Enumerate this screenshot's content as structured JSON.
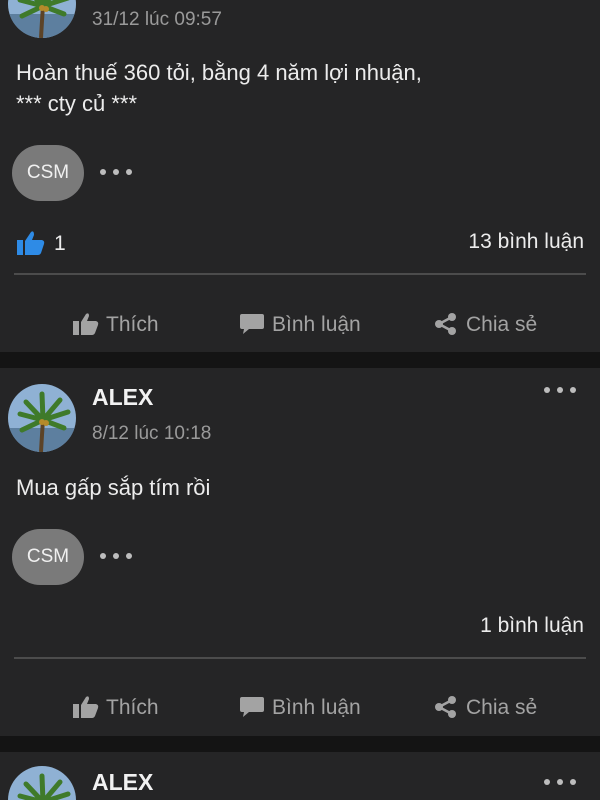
{
  "posts": [
    {
      "author": "",
      "time": "31/12 lúc 09:57",
      "text": "Hoàn thuế 360 tỏi, bằng 4 năm lợi nhuận,\n*** cty củ ***",
      "reaction_chip": "CSM",
      "like_count": "1",
      "comment_count": "13 bình luận",
      "actions": {
        "like": "Thích",
        "comment": "Bình luận",
        "share": "Chia sẻ"
      }
    },
    {
      "author": "ALEX",
      "time": "8/12 lúc 10:18",
      "text": "Mua gấp sắp tím rồi",
      "reaction_chip": "CSM",
      "like_count": "",
      "comment_count": "1 bình luận",
      "actions": {
        "like": "Thích",
        "comment": "Bình luận",
        "share": "Chia sẻ"
      }
    },
    {
      "author": "ALEX"
    }
  ],
  "icons": {
    "avatar": "palm-tree-avatar",
    "more": "more-dots-icon",
    "like_reaction": "thumbs-up-reaction-icon",
    "like_action": "thumbs-up-icon",
    "comment_action": "comment-bubble-icon",
    "share_action": "share-icon"
  },
  "colors": {
    "background": "#141414",
    "card": "#252526",
    "like_blue": "#2e8be6",
    "chip": "#7a7a7a",
    "muted_text": "#9a9a9a"
  }
}
